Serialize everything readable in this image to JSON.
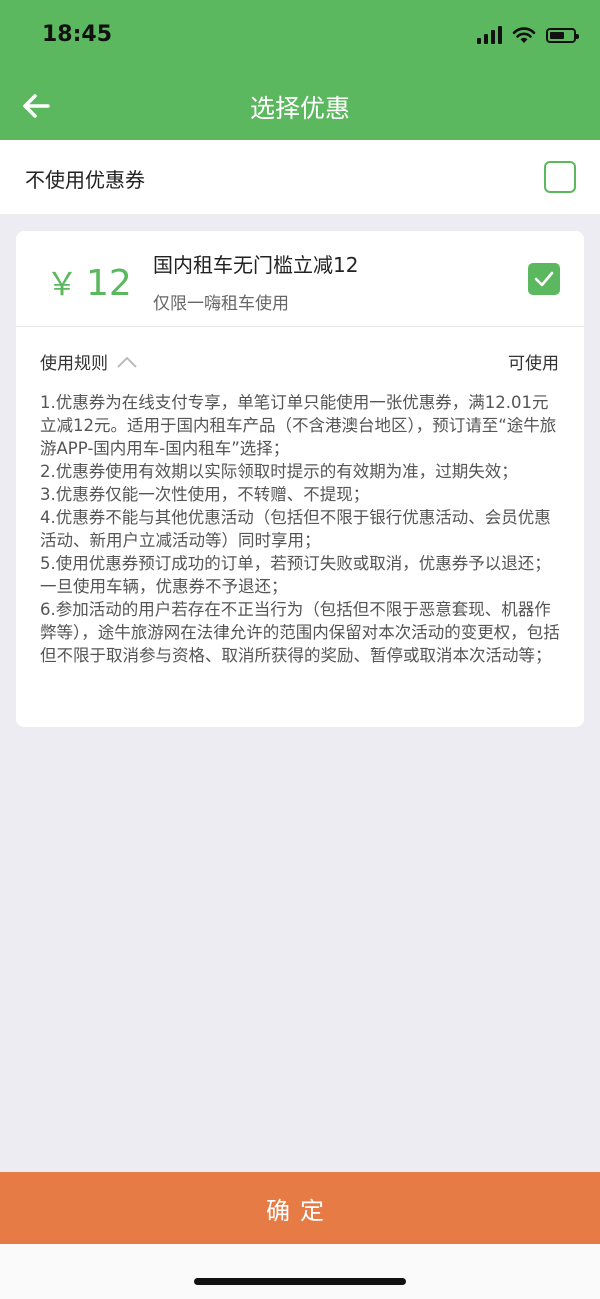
{
  "status_bar": {
    "time": "18:45",
    "battery_level": 0.55
  },
  "header": {
    "title": "选择优惠"
  },
  "no_coupon": {
    "label": "不使用优惠券",
    "checked": false
  },
  "coupon": {
    "currency": "￥",
    "amount": "12",
    "title": "国内租车无门槛立减12",
    "subtitle": "仅限一嗨租车使用",
    "checked": true,
    "rules_label": "使用规则",
    "status": "可使用",
    "rules": [
      "1.优惠券为在线支付专享，单笔订单只能使用一张优惠券，满12.01元立减12元。适用于国内租车产品（不含港澳台地区），预订请至“途牛旅游APP-国内用车-国内租车”选择；",
      "2.优惠券使用有效期以实际领取时提示的有效期为准，过期失效；",
      "3.优惠券仅能一次性使用，不转赠、不提现；",
      "4.优惠券不能与其他优惠活动（包括但不限于银行优惠活动、会员优惠活动、新用户立减活动等）同时享用；",
      "5.使用优惠券预订成功的订单，若预订失败或取消，优惠券予以退还；一旦使用车辆，优惠券不予退还；",
      "6.参加活动的用户若存在不正当行为（包括但不限于恶意套现、机器作弊等），途牛旅游网在法律允许的范围内保留对本次活动的变更权，包括但不限于取消参与资格、取消所获得的奖励、暂停或取消本次活动等；"
    ]
  },
  "footer": {
    "confirm_label": "确定"
  },
  "colors": {
    "primary": "#5cb85f",
    "confirm": "#e67b45",
    "background": "#ececf2"
  },
  "icons": [
    "back-arrow-icon",
    "signal-icon",
    "wifi-icon",
    "battery-icon",
    "checkmark-icon",
    "chevron-up-icon"
  ]
}
